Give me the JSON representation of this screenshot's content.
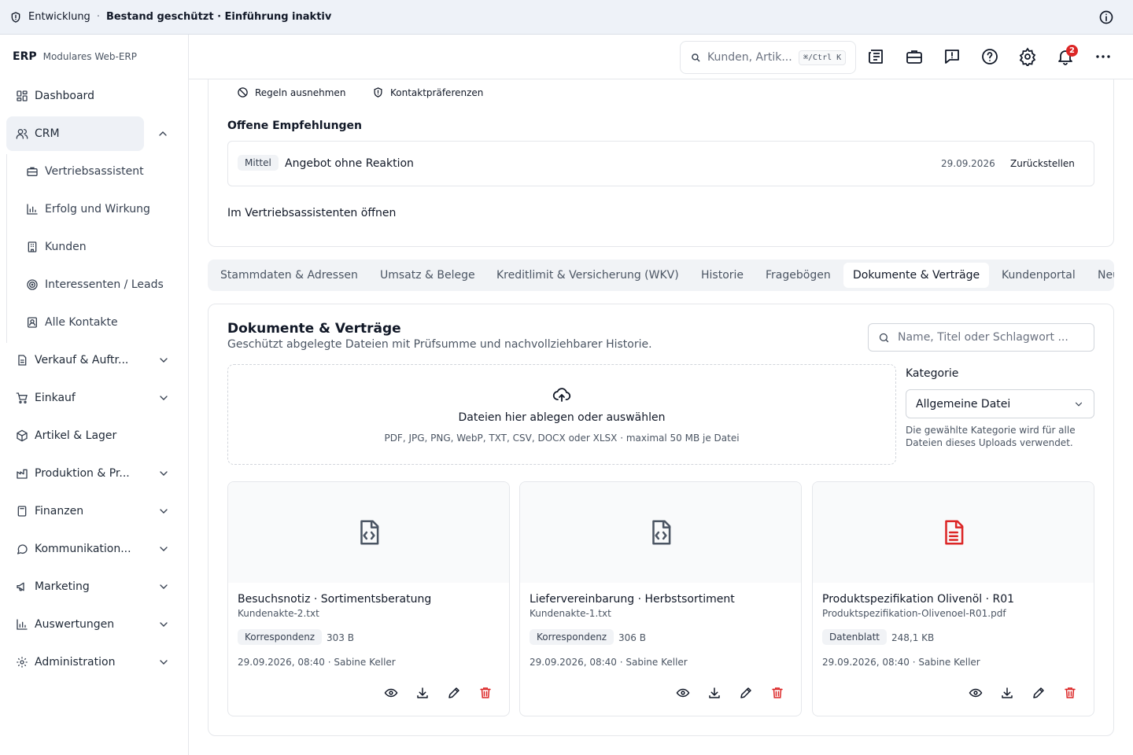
{
  "banner": {
    "env": "Entwicklung",
    "sep": "·",
    "state": "Bestand geschützt · Einführung inaktiv"
  },
  "brand": {
    "logo": "ERP",
    "tagline": "Modulares Web-ERP"
  },
  "nav": {
    "dashboard": "Dashboard",
    "crm": "CRM",
    "sub": [
      "Vertriebsassistent",
      "Erfolg und Wirkung",
      "Kunden",
      "Interessenten / Leads",
      "Alle Kontakte"
    ],
    "verkauf": "Verkauf & Auftr...",
    "einkauf": "Einkauf",
    "artikel": "Artikel & Lager",
    "produktion": "Produktion & Pr...",
    "finanzen": "Finanzen",
    "kommunikation": "Kommunikation...",
    "marketing": "Marketing",
    "auswertungen": "Auswertungen",
    "administration": "Administration"
  },
  "header": {
    "search_placeholder": "Kunden, Artik...",
    "shortcut": "⌘/Ctrl K",
    "notifications": "2"
  },
  "recommendations": {
    "action_exclude": "Regeln ausnehmen",
    "action_contact": "Kontaktpräferenzen",
    "title": "Offene Empfehlungen",
    "item": {
      "priority": "Mittel",
      "text": "Angebot ohne Reaktion",
      "date": "29.09.2026",
      "action": "Zurückstellen"
    },
    "open_link": "Im Vertriebsassistenten öffnen"
  },
  "tabs": [
    "Stammdaten & Adressen",
    "Umsatz & Belege",
    "Kreditlimit & Versicherung (WKV)",
    "Historie",
    "Fragebögen",
    "Dokumente & Verträge",
    "Kundenportal",
    "Neu"
  ],
  "documents": {
    "title": "Dokumente & Verträge",
    "subtitle": "Geschützt abgelegte Dateien mit Prüfsumme und nachvollziehbarer Historie.",
    "search_placeholder": "Name, Titel oder Schlagwort ...",
    "drop_title": "Dateien hier ablegen oder auswählen",
    "drop_hint": "PDF, JPG, PNG, WebP, TXT, CSV, DOCX oder XLSX · maximal 50 MB je Datei",
    "category_label": "Kategorie",
    "category_value": "Allgemeine Datei",
    "category_hint": "Die gewählte Kategorie wird für alle Dateien dieses Uploads verwendet.",
    "files": [
      {
        "name": "Besuchsnotiz · Sortimentsberatung",
        "file": "Kundenakte-2.txt",
        "category": "Korrespondenz",
        "size": "303 B",
        "meta": "29.09.2026, 08:40 · Sabine Keller",
        "icon": "file-code-icon",
        "icon_color": "#4b5563"
      },
      {
        "name": "Liefervereinbarung · Herbstsortiment",
        "file": "Kundenakte-1.txt",
        "category": "Korrespondenz",
        "size": "306 B",
        "meta": "29.09.2026, 08:40 · Sabine Keller",
        "icon": "file-code-icon",
        "icon_color": "#4b5563"
      },
      {
        "name": "Produktspezifikation Olivenöl · R01",
        "file": "Produktspezifikation-Olivenoel-R01.pdf",
        "category": "Datenblatt",
        "size": "248,1 KB",
        "meta": "29.09.2026, 08:40 · Sabine Keller",
        "icon": "file-text-icon",
        "icon_color": "#dc2626"
      }
    ]
  },
  "colors": {
    "accent_bg": "#eef1f6",
    "danger": "#dc2626",
    "banner_bg": "#eef2f8"
  }
}
